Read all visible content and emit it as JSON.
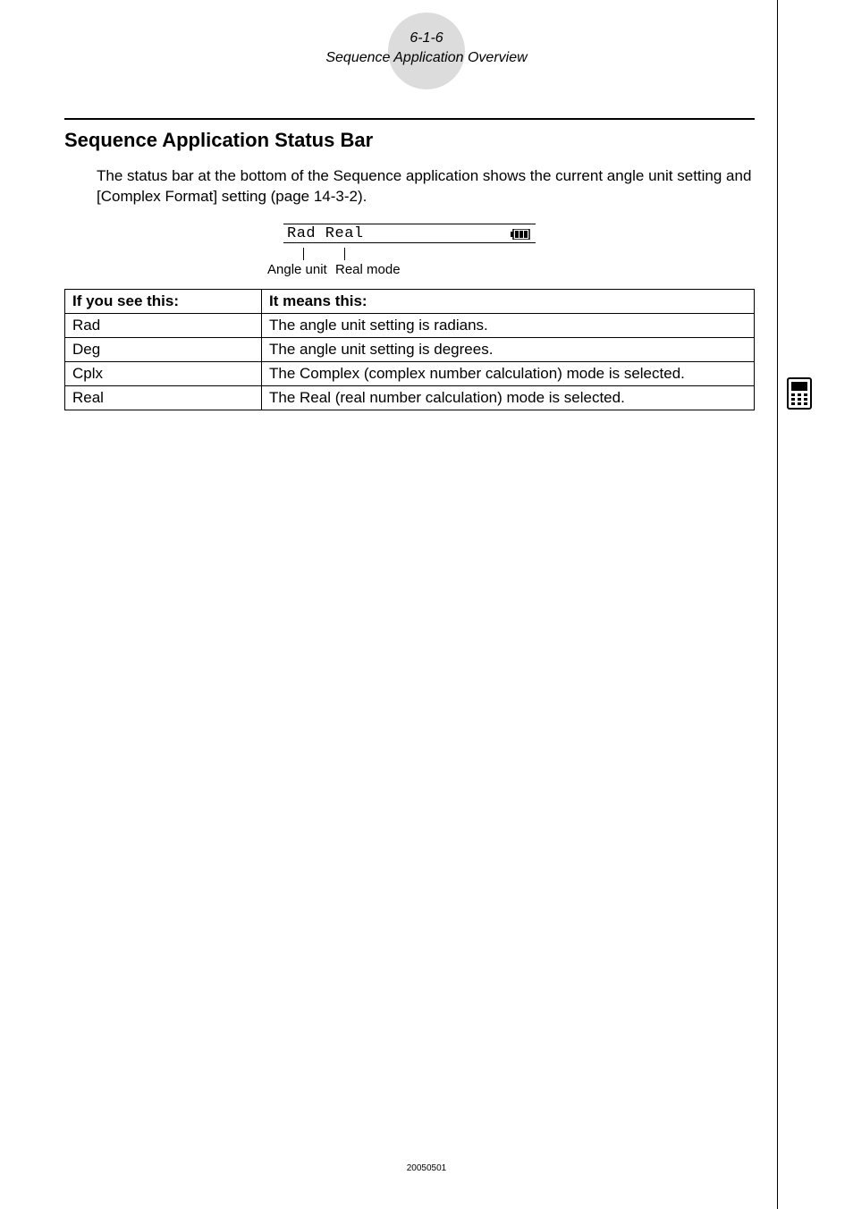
{
  "header": {
    "page_ref": "6-1-6",
    "section": "Sequence Application Overview"
  },
  "title": "Sequence Application Status Bar",
  "intro": "The status bar at the bottom of the Sequence application shows the current angle unit setting and [Complex Format] setting (page 14-3-2).",
  "statusbar": {
    "display": "Rad Real",
    "callout_angle": "Angle unit",
    "callout_mode": "Real mode"
  },
  "table": {
    "head_key": "If you see this:",
    "head_val": "It means this:",
    "rows": [
      {
        "k": "Rad",
        "v": "The angle unit setting is radians."
      },
      {
        "k": "Deg",
        "v": "The angle unit setting is degrees."
      },
      {
        "k": "Cplx",
        "v": "The Complex (complex number calculation) mode is selected."
      },
      {
        "k": "Real",
        "v": "The Real (real number calculation) mode is selected."
      }
    ]
  },
  "footer_code": "20050501"
}
